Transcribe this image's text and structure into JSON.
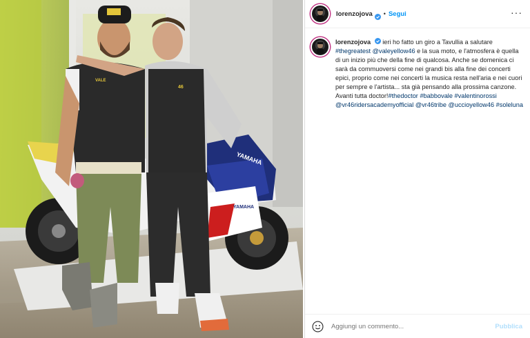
{
  "header": {
    "username": "lorenzojova",
    "separator": "•",
    "follow_label": "Segui",
    "more_icon": "more-options-icon"
  },
  "caption": {
    "username": "lorenzojova",
    "parts": [
      {
        "t": "ieri ho fatto un giro a Tavullia a salutare ",
        "tag": false
      },
      {
        "t": "#thegreatest",
        "tag": true
      },
      {
        "t": " ",
        "tag": false
      },
      {
        "t": "@valeyellow46",
        "tag": true
      },
      {
        "t": " e la sua moto, e l'atmosfera è quella di un inizio più che della fine di qualcosa. Anche se domenica ci sarà da commuoversi come nei grandi bis alla fine dei concerti epici, proprio come nei concerti la musica resta nell'aria e nei cuori per sempre e l'artista... sta già pensando alla prossima canzone. Avanti tutta doctor!",
        "tag": false
      },
      {
        "t": "#thedoctor",
        "tag": true
      },
      {
        "t": " ",
        "tag": false
      },
      {
        "t": "#babbovale",
        "tag": true
      },
      {
        "t": " ",
        "tag": false
      },
      {
        "t": "#valentinorossi",
        "tag": true
      },
      {
        "t": " ",
        "tag": false
      },
      {
        "t": "@vr46ridersacademyofficial",
        "tag": true
      },
      {
        "t": " ",
        "tag": false
      },
      {
        "t": "@vr46tribe",
        "tag": true
      },
      {
        "t": " ",
        "tag": false
      },
      {
        "t": "@uccioyellow46",
        "tag": true
      },
      {
        "t": " ",
        "tag": false
      },
      {
        "t": "#soleluna",
        "tag": true
      }
    ]
  },
  "footer": {
    "comment_placeholder": "Aggiungi un commento...",
    "publish_label": "Pubblica"
  },
  "photo": {
    "bike_brand": "YAMAHA",
    "vest_brand": "VALE",
    "number": "46"
  },
  "colors": {
    "link": "#00376b",
    "follow": "#0095f6",
    "publish_disabled": "#b2dffc"
  }
}
